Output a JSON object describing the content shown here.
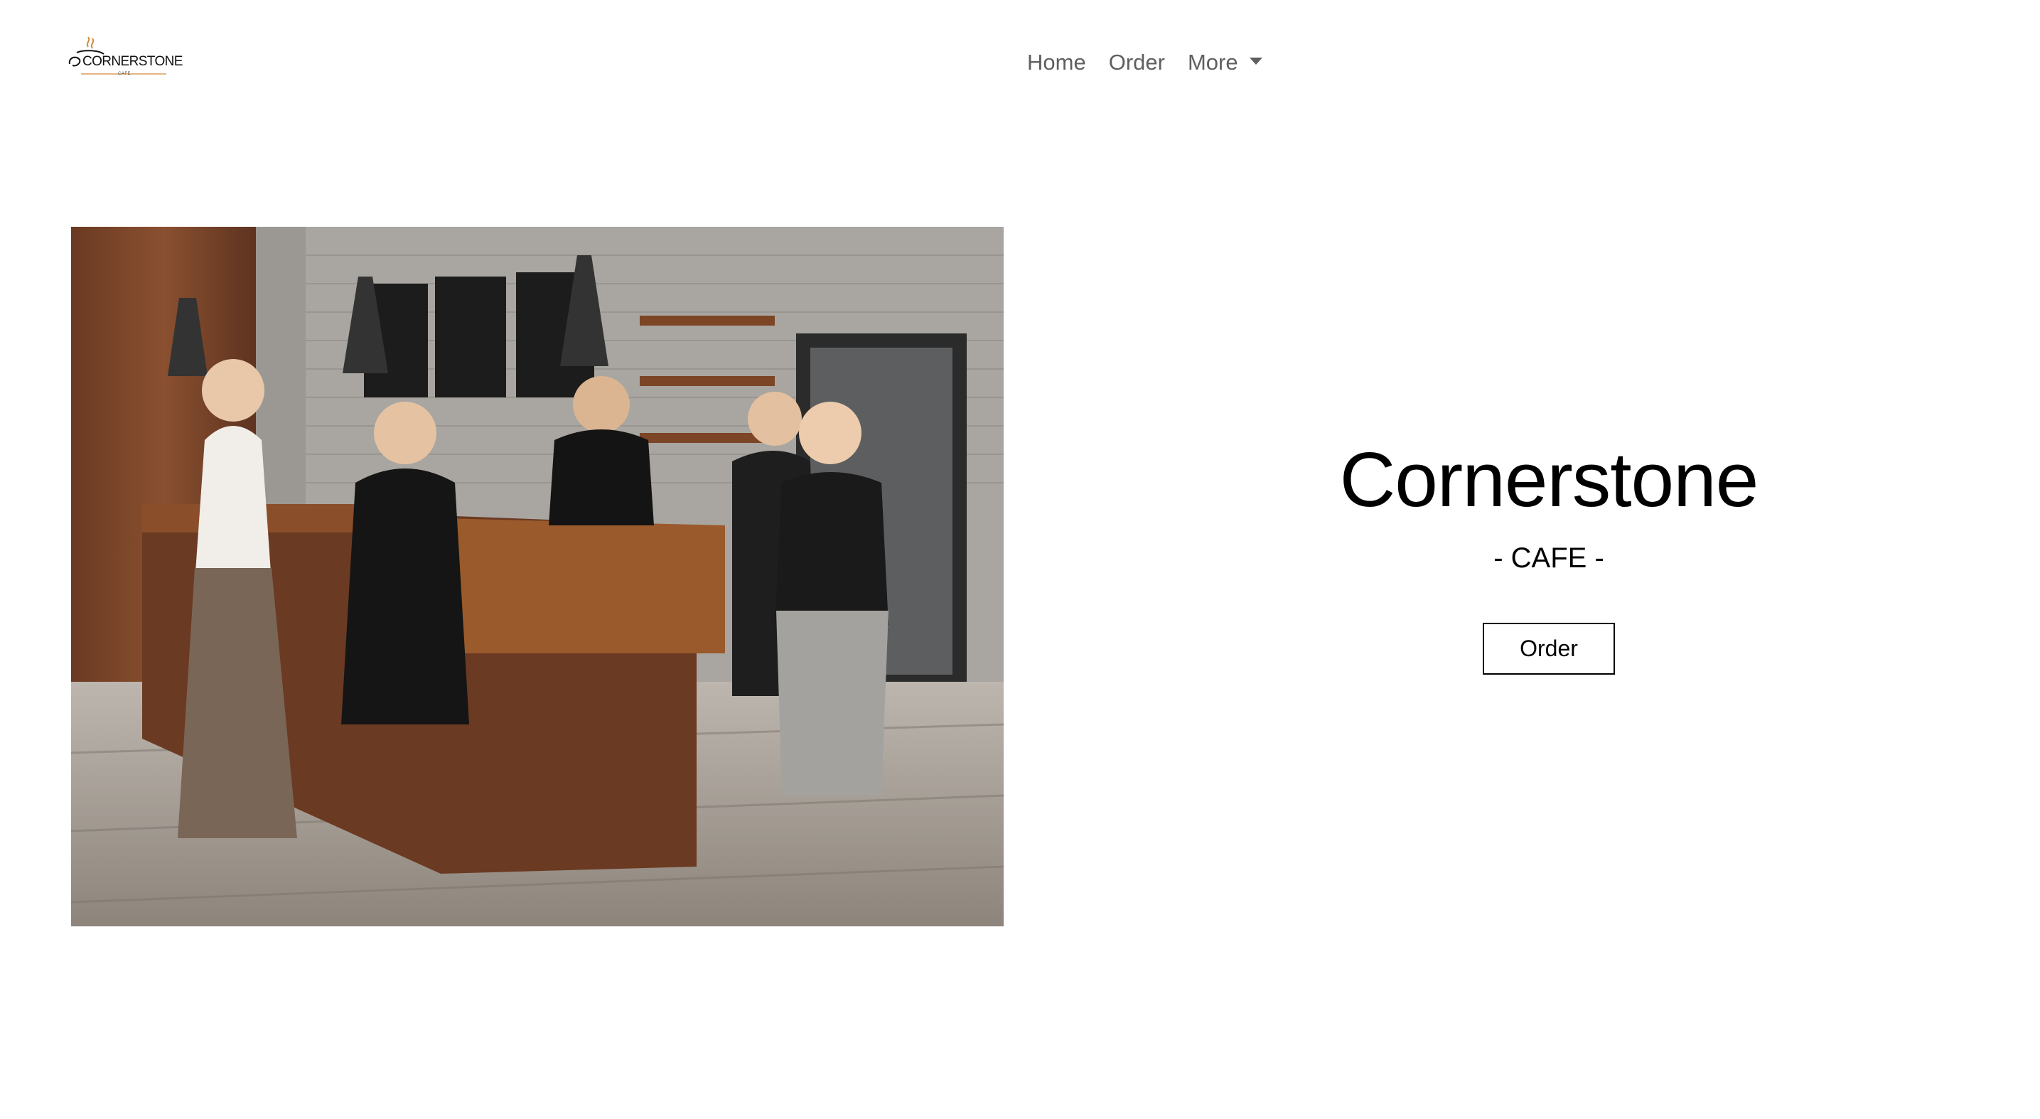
{
  "brand": {
    "name": "CORNERSTONE",
    "tagline": "CAFE"
  },
  "nav": {
    "items": [
      {
        "label": "Home"
      },
      {
        "label": "Order"
      },
      {
        "label": "More"
      }
    ]
  },
  "hero": {
    "title": "Cornerstone",
    "subtitle": "- CAFE -",
    "button_label": "Order"
  },
  "colors": {
    "nav_text": "#5f5f5f",
    "logo_accent": "#d58a3a",
    "text": "#000000",
    "background": "#ffffff"
  }
}
